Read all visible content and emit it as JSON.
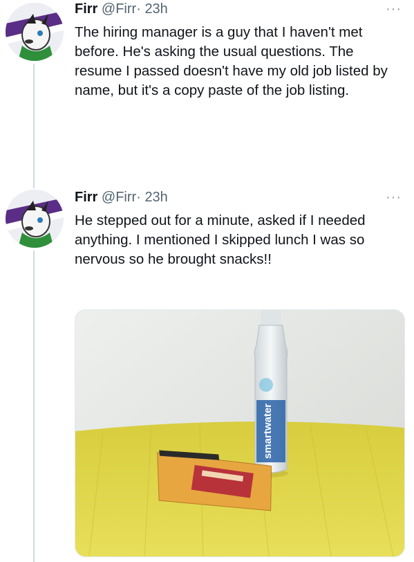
{
  "tweets": [
    {
      "name": "Firr",
      "handle": "@Firr",
      "separator": "·",
      "time": "23h",
      "more": "···",
      "text": "The hiring manager is a guy that I haven't met before. He's asking the usual questions.  The resume I passed doesn't have my old job listed by name, but it's a copy paste of the job listing."
    },
    {
      "name": "Firr",
      "handle": "@Firr",
      "separator": "·",
      "time": "23h",
      "more": "···",
      "text": "He stepped out for a minute, asked if I needed anything. I mentioned I skipped lunch I was so nervous so he brought snacks!!"
    }
  ],
  "photo": {
    "bottle_label": "smartwater"
  },
  "colors": {
    "handle_gray": "#536471",
    "thread_line": "#cfd9de",
    "table_yellow": "#e3d64a"
  }
}
